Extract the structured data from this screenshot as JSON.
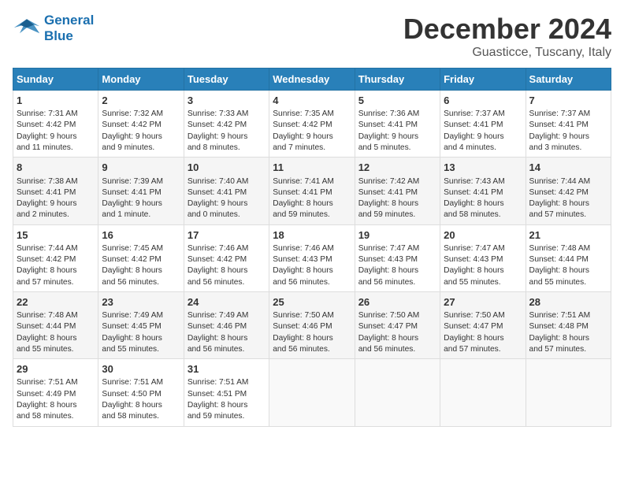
{
  "logo": {
    "line1": "General",
    "line2": "Blue"
  },
  "title": "December 2024",
  "subtitle": "Guasticce, Tuscany, Italy",
  "days_of_week": [
    "Sunday",
    "Monday",
    "Tuesday",
    "Wednesday",
    "Thursday",
    "Friday",
    "Saturday"
  ],
  "weeks": [
    [
      {
        "day": "1",
        "detail": "Sunrise: 7:31 AM\nSunset: 4:42 PM\nDaylight: 9 hours\nand 11 minutes."
      },
      {
        "day": "2",
        "detail": "Sunrise: 7:32 AM\nSunset: 4:42 PM\nDaylight: 9 hours\nand 9 minutes."
      },
      {
        "day": "3",
        "detail": "Sunrise: 7:33 AM\nSunset: 4:42 PM\nDaylight: 9 hours\nand 8 minutes."
      },
      {
        "day": "4",
        "detail": "Sunrise: 7:35 AM\nSunset: 4:42 PM\nDaylight: 9 hours\nand 7 minutes."
      },
      {
        "day": "5",
        "detail": "Sunrise: 7:36 AM\nSunset: 4:41 PM\nDaylight: 9 hours\nand 5 minutes."
      },
      {
        "day": "6",
        "detail": "Sunrise: 7:37 AM\nSunset: 4:41 PM\nDaylight: 9 hours\nand 4 minutes."
      },
      {
        "day": "7",
        "detail": "Sunrise: 7:37 AM\nSunset: 4:41 PM\nDaylight: 9 hours\nand 3 minutes."
      }
    ],
    [
      {
        "day": "8",
        "detail": "Sunrise: 7:38 AM\nSunset: 4:41 PM\nDaylight: 9 hours\nand 2 minutes."
      },
      {
        "day": "9",
        "detail": "Sunrise: 7:39 AM\nSunset: 4:41 PM\nDaylight: 9 hours\nand 1 minute."
      },
      {
        "day": "10",
        "detail": "Sunrise: 7:40 AM\nSunset: 4:41 PM\nDaylight: 9 hours\nand 0 minutes."
      },
      {
        "day": "11",
        "detail": "Sunrise: 7:41 AM\nSunset: 4:41 PM\nDaylight: 8 hours\nand 59 minutes."
      },
      {
        "day": "12",
        "detail": "Sunrise: 7:42 AM\nSunset: 4:41 PM\nDaylight: 8 hours\nand 59 minutes."
      },
      {
        "day": "13",
        "detail": "Sunrise: 7:43 AM\nSunset: 4:41 PM\nDaylight: 8 hours\nand 58 minutes."
      },
      {
        "day": "14",
        "detail": "Sunrise: 7:44 AM\nSunset: 4:42 PM\nDaylight: 8 hours\nand 57 minutes."
      }
    ],
    [
      {
        "day": "15",
        "detail": "Sunrise: 7:44 AM\nSunset: 4:42 PM\nDaylight: 8 hours\nand 57 minutes."
      },
      {
        "day": "16",
        "detail": "Sunrise: 7:45 AM\nSunset: 4:42 PM\nDaylight: 8 hours\nand 56 minutes."
      },
      {
        "day": "17",
        "detail": "Sunrise: 7:46 AM\nSunset: 4:42 PM\nDaylight: 8 hours\nand 56 minutes."
      },
      {
        "day": "18",
        "detail": "Sunrise: 7:46 AM\nSunset: 4:43 PM\nDaylight: 8 hours\nand 56 minutes."
      },
      {
        "day": "19",
        "detail": "Sunrise: 7:47 AM\nSunset: 4:43 PM\nDaylight: 8 hours\nand 56 minutes."
      },
      {
        "day": "20",
        "detail": "Sunrise: 7:47 AM\nSunset: 4:43 PM\nDaylight: 8 hours\nand 55 minutes."
      },
      {
        "day": "21",
        "detail": "Sunrise: 7:48 AM\nSunset: 4:44 PM\nDaylight: 8 hours\nand 55 minutes."
      }
    ],
    [
      {
        "day": "22",
        "detail": "Sunrise: 7:48 AM\nSunset: 4:44 PM\nDaylight: 8 hours\nand 55 minutes."
      },
      {
        "day": "23",
        "detail": "Sunrise: 7:49 AM\nSunset: 4:45 PM\nDaylight: 8 hours\nand 55 minutes."
      },
      {
        "day": "24",
        "detail": "Sunrise: 7:49 AM\nSunset: 4:46 PM\nDaylight: 8 hours\nand 56 minutes."
      },
      {
        "day": "25",
        "detail": "Sunrise: 7:50 AM\nSunset: 4:46 PM\nDaylight: 8 hours\nand 56 minutes."
      },
      {
        "day": "26",
        "detail": "Sunrise: 7:50 AM\nSunset: 4:47 PM\nDaylight: 8 hours\nand 56 minutes."
      },
      {
        "day": "27",
        "detail": "Sunrise: 7:50 AM\nSunset: 4:47 PM\nDaylight: 8 hours\nand 57 minutes."
      },
      {
        "day": "28",
        "detail": "Sunrise: 7:51 AM\nSunset: 4:48 PM\nDaylight: 8 hours\nand 57 minutes."
      }
    ],
    [
      {
        "day": "29",
        "detail": "Sunrise: 7:51 AM\nSunset: 4:49 PM\nDaylight: 8 hours\nand 58 minutes."
      },
      {
        "day": "30",
        "detail": "Sunrise: 7:51 AM\nSunset: 4:50 PM\nDaylight: 8 hours\nand 58 minutes."
      },
      {
        "day": "31",
        "detail": "Sunrise: 7:51 AM\nSunset: 4:51 PM\nDaylight: 8 hours\nand 59 minutes."
      },
      {
        "day": "",
        "detail": ""
      },
      {
        "day": "",
        "detail": ""
      },
      {
        "day": "",
        "detail": ""
      },
      {
        "day": "",
        "detail": ""
      }
    ]
  ]
}
